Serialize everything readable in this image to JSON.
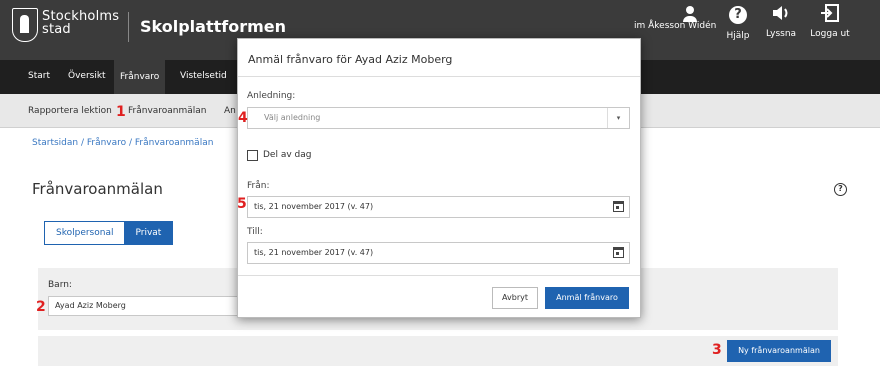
{
  "header": {
    "logo_text_line1": "Stockholms",
    "logo_text_line2": "stad",
    "product_name": "Skolplattformen",
    "user_name": "im Åkesson Widén",
    "buttons": [
      {
        "icon": "user-icon",
        "label": ""
      },
      {
        "icon": "help-icon",
        "label": "Hjälp"
      },
      {
        "icon": "speaker-icon",
        "label": "Lyssna"
      },
      {
        "icon": "logout-icon",
        "label": "Logga ut"
      }
    ]
  },
  "main_nav": {
    "items": [
      "Start",
      "Översikt",
      "Frånvaro",
      "Vistelsetid"
    ],
    "active": "Frånvaro"
  },
  "sub_nav": {
    "items": [
      "Rapportera lektion",
      "Frånvaroanmälan",
      "An"
    ]
  },
  "breadcrumb": "Startsidan / Frånvaro / Frånvaroanmälan",
  "page": {
    "title": "Frånvaroanmälan",
    "help_glyph": "?",
    "toggle": {
      "options": [
        "Skolpersonal",
        "Privat"
      ],
      "selected": "Privat"
    },
    "barn_label": "Barn:",
    "barn_value": "Ayad Aziz Moberg",
    "new_button": "Ny frånvaroanmälan"
  },
  "modal": {
    "title": "Anmäl frånvaro för Ayad Aziz Moberg",
    "reason_label": "Anledning:",
    "reason_placeholder": "Välj anledning",
    "part_of_day_label": "Del av dag",
    "from_label": "Från:",
    "from_value": "tis, 21 november 2017 (v. 47)",
    "to_label": "Till:",
    "to_value": "tis, 21 november 2017 (v. 47)",
    "cancel_label": "Avbryt",
    "submit_label": "Anmäl frånvaro"
  },
  "annotations": [
    "1",
    "2",
    "3",
    "4",
    "5"
  ],
  "colors": {
    "header_bg": "#3b3b3b",
    "nav_bg": "#1f1f1f",
    "accent": "#1f63b0",
    "marker": "#e02020"
  }
}
